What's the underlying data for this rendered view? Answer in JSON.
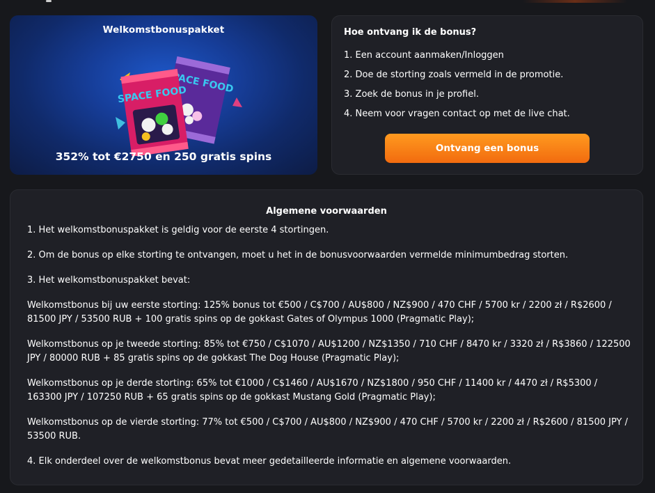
{
  "promo": {
    "title": "Welkomstbonuspakket",
    "offer": "352% tot €2750 en 250 gratis spins",
    "image_label": "SPACE FOOD"
  },
  "howto": {
    "title": "Hoe ontvang ik de bonus?",
    "steps": [
      "1. Een account aanmaken/Inloggen",
      "2. Doe de storting zoals vermeld in de promotie.",
      "3. Zoek de bonus in je profiel.",
      "4. Neem voor vragen contact op met de live chat."
    ],
    "button_label": "Ontvang een bonus"
  },
  "terms": {
    "title": "Algemene voorwaarden",
    "paragraphs": [
      "1. Het welkomstbonuspakket is geldig voor de eerste 4 stortingen.",
      "2. Om de bonus op elke storting te ontvangen, moet u het in de bonusvoorwaarden vermelde minimumbedrag storten.",
      "3. Het welkomstbonuspakket bevat:",
      "Welkomstbonus bij uw eerste storting: 125% bonus tot €500 / C$700 / AU$800 / NZ$900 / 470 CHF / 5700 kr / 2200 zł / R$2600 / 81500 JPY / 53500 RUB + 100 gratis spins op de gokkast Gates of Olympus 1000 (Pragmatic Play);",
      "Welkomstbonus op je tweede storting: 85% tot €750 / C$1070 / AU$1200 / NZ$1350 / 710 CHF / 8470 kr / 3320 zł / R$3860 / 122500 JPY / 80000 RUB + 85 gratis spins op de gokkast The Dog House (Pragmatic Play);",
      "Welkomstbonus op je derde storting: 65% tot €1000 / C$1460 / AU$1670 / NZ$1800 / 950 CHF / 11400 kr / 4470 zł / R$5300 / 163300 JPY / 107250 RUB + 65 gratis spins op de gokkast Mustang Gold (Pragmatic Play);",
      "Welkomstbonus op de vierde storting: 77% tot €500 / C$700 / AU$800 / NZ$900 / 470 CHF / 5700 kr / 2200 zł / R$2600 / 81500 JPY / 53500 RUB.",
      "4. Elk onderdeel over de welkomstbonus bevat meer gedetailleerde informatie en algemene voorwaarden."
    ]
  },
  "colors": {
    "page_bg": "#17181c",
    "card_bg": "#1f2026",
    "promo_bg": "#163d98",
    "button_orange": "#f7821a"
  }
}
